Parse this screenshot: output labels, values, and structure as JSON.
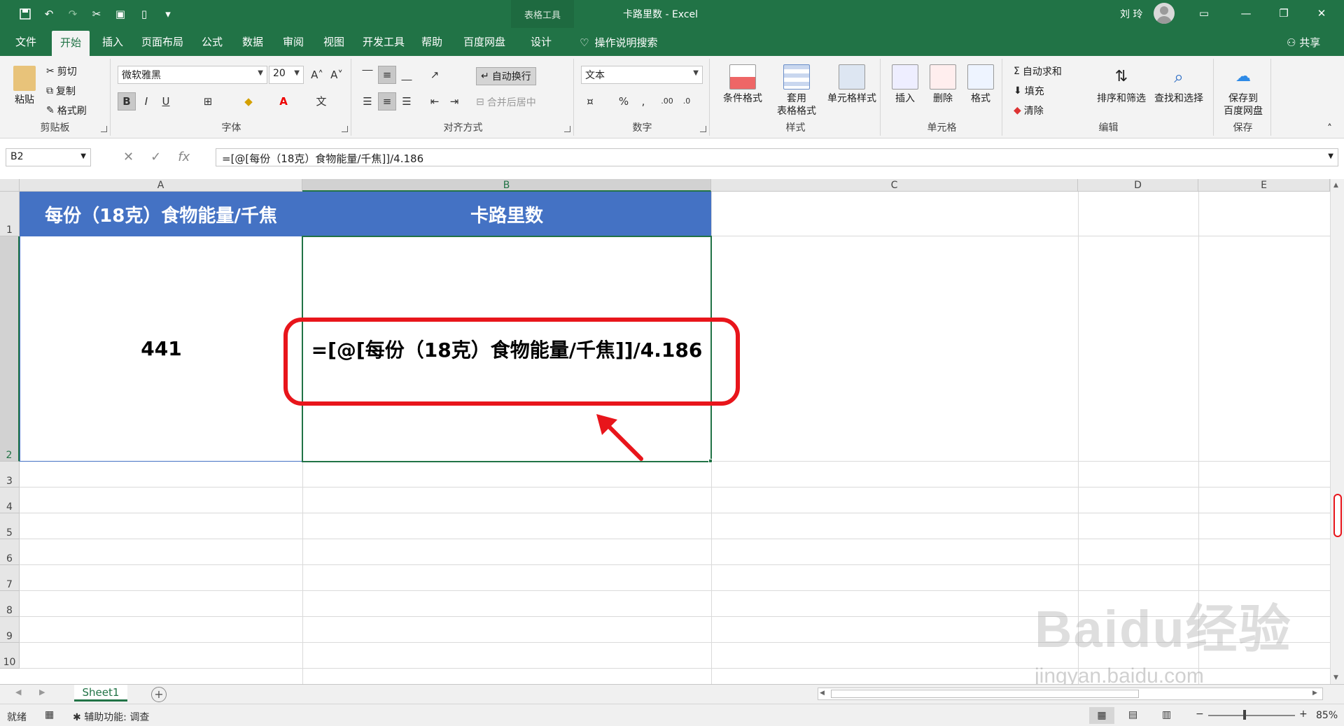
{
  "window": {
    "title": "卡路里数 - Excel",
    "context_tab": "表格工具",
    "user": "刘 玲"
  },
  "ribbon_tabs": [
    "文件",
    "开始",
    "插入",
    "页面布局",
    "公式",
    "数据",
    "审阅",
    "视图",
    "开发工具",
    "帮助",
    "百度网盘",
    "设计"
  ],
  "tell_me": "操作说明搜索",
  "share": "共享",
  "clipboard": {
    "paste": "粘贴",
    "cut": "剪切",
    "copy": "复制",
    "format_painter": "格式刷",
    "label": "剪贴板"
  },
  "font": {
    "name": "微软雅黑",
    "size": "20",
    "label": "字体",
    "bold": "B",
    "italic": "I",
    "underline": "U"
  },
  "alignment": {
    "wrap": "自动换行",
    "merge": "合并后居中",
    "label": "对齐方式"
  },
  "number": {
    "format": "文本",
    "label": "数字"
  },
  "styles": {
    "conditional": "条件格式",
    "table_format_1": "套用",
    "table_format_2": "表格格式",
    "cell_styles": "单元格样式",
    "label": "样式"
  },
  "cells": {
    "insert": "插入",
    "delete": "删除",
    "format": "格式",
    "label": "单元格"
  },
  "editing": {
    "autosum": "自动求和",
    "fill": "填充",
    "clear": "清除",
    "sort": "排序和筛选",
    "find": "查找和选择",
    "label": "编辑"
  },
  "save": {
    "line1": "保存到",
    "line2": "百度网盘",
    "label": "保存"
  },
  "formula_bar": {
    "name_box": "B2",
    "formula": "=[@[每份（18克）食物能量/千焦]]/4.186"
  },
  "columns": [
    "A",
    "B",
    "C",
    "D",
    "E"
  ],
  "rows": [
    "1",
    "2",
    "3",
    "4",
    "5",
    "6",
    "7",
    "8",
    "9",
    "10"
  ],
  "table": {
    "header_a": "每份（18克）食物能量/千焦",
    "header_b": "卡路里数",
    "value_a": "441",
    "value_b": "=[@[每份（18克）食物能量/千焦]]/4.186"
  },
  "sheet_tab": "Sheet1",
  "status": {
    "ready": "就绪",
    "accessibility": "辅助功能: 调查",
    "zoom": "85%"
  },
  "watermark": {
    "brand": "Baidu经验",
    "url": "jingyan.baidu.com"
  },
  "colors": {
    "excel_green": "#217346",
    "header_blue": "#4472c4",
    "annotation_red": "#e8151b"
  }
}
